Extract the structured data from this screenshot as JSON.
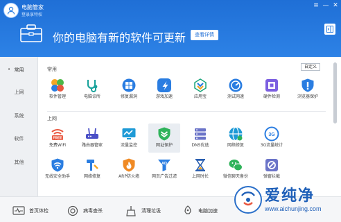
{
  "window": {
    "app_name": "电脑管家",
    "login_text": "登录享特权",
    "controls": {
      "menu": "≡",
      "minimize": "—",
      "close": "✕"
    }
  },
  "banner": {
    "headline": "你的电脑有新的软件可更新",
    "details_button": "查看详情"
  },
  "sidebar": {
    "items": [
      {
        "label": "常用",
        "active": true
      },
      {
        "label": "上网",
        "active": false
      },
      {
        "label": "系统",
        "active": false
      },
      {
        "label": "软件",
        "active": false
      },
      {
        "label": "其他",
        "active": false
      }
    ]
  },
  "main": {
    "custom_button": "自定义",
    "sections": [
      {
        "title": "常用",
        "tools": [
          {
            "label": "软件管理",
            "icon": "software-manager-icon"
          },
          {
            "label": "电脑诊所",
            "icon": "pc-clinic-icon"
          },
          {
            "label": "修复漏洞",
            "icon": "fix-vulnerability-icon"
          },
          {
            "label": "游戏加速",
            "icon": "game-boost-icon"
          },
          {
            "label": "应用宝",
            "icon": "app-store-icon"
          },
          {
            "label": "测试网速",
            "icon": "speed-test-icon"
          },
          {
            "label": "硬件检测",
            "icon": "hardware-check-icon"
          },
          {
            "label": "浏览器保护",
            "icon": "browser-protect-icon"
          }
        ]
      },
      {
        "title": "上网",
        "tools": [
          {
            "label": "免费WiFi",
            "icon": "free-wifi-icon"
          },
          {
            "label": "路由器管家",
            "icon": "router-icon"
          },
          {
            "label": "流量监控",
            "icon": "traffic-monitor-icon"
          },
          {
            "label": "网址保护",
            "icon": "url-protect-icon",
            "selected": true
          },
          {
            "label": "DNS优选",
            "icon": "dns-icon"
          },
          {
            "label": "网络修复",
            "icon": "network-fix-icon"
          },
          {
            "label": "3G流量统计",
            "icon": "3g-traffic-icon"
          },
          {
            "label": "无线安全助手",
            "icon": "wireless-security-icon"
          },
          {
            "label": "网络修复",
            "icon": "network-repair-icon"
          },
          {
            "label": "ARP防火墙",
            "icon": "arp-firewall-icon"
          },
          {
            "label": "网页广告过滤",
            "icon": "ad-filter-icon"
          },
          {
            "label": "上网时长",
            "icon": "online-time-icon"
          },
          {
            "label": "微信聊天备份",
            "icon": "wechat-backup-icon"
          },
          {
            "label": "弹窗拦截",
            "icon": "popup-block-icon"
          }
        ]
      }
    ]
  },
  "bottom_bar": {
    "items": [
      {
        "label": "首页体检",
        "icon": "checkup-icon"
      },
      {
        "label": "病毒查杀",
        "icon": "virus-scan-icon"
      },
      {
        "label": "清理垃圾",
        "icon": "cleanup-icon"
      },
      {
        "label": "电脑加速",
        "icon": "speedup-icon"
      }
    ]
  },
  "watermark": {
    "text": "爱纯净",
    "url": "www.aichunjing.com"
  },
  "colors": {
    "header_blue": "#1f6fd6",
    "accent_blue": "#2a7de1",
    "sidebar_bg": "#eef0f3"
  }
}
